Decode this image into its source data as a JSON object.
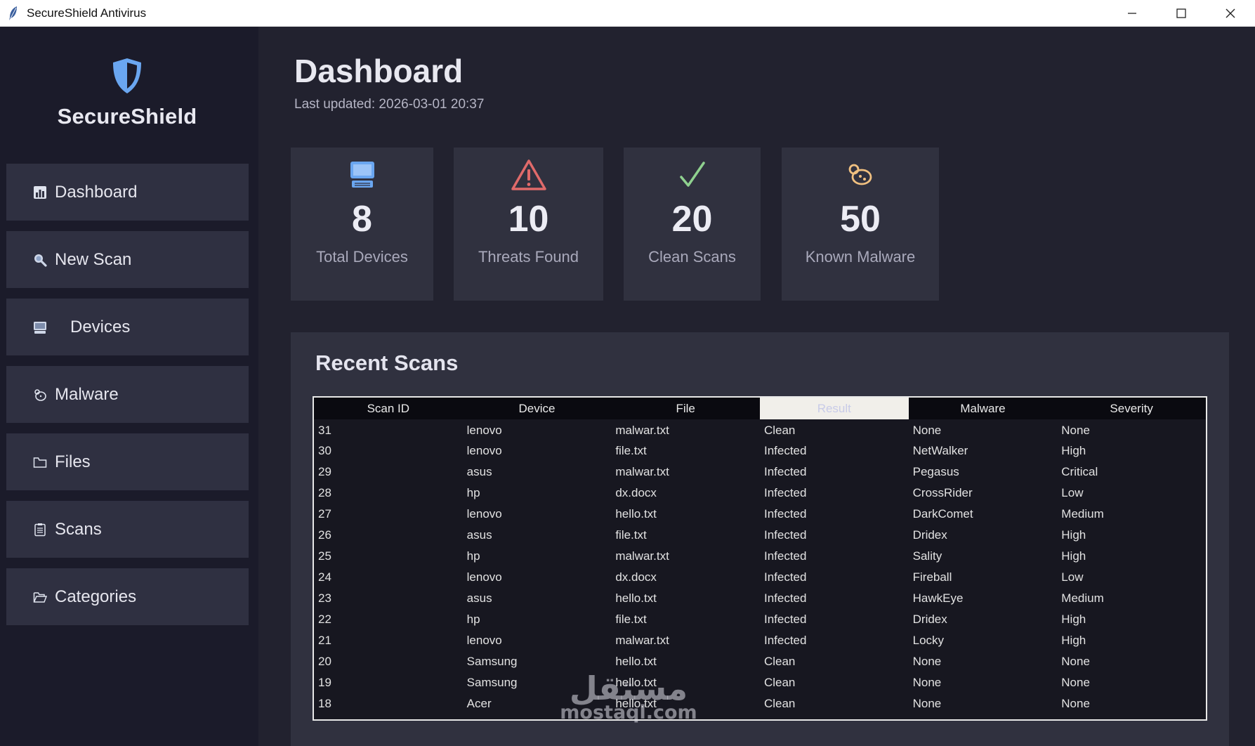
{
  "window": {
    "title": "SecureShield Antivirus"
  },
  "sidebar": {
    "brand": "SecureShield",
    "items": [
      {
        "label": "Dashboard",
        "icon": "bar-chart-icon"
      },
      {
        "label": "New Scan",
        "icon": "magnifier-icon"
      },
      {
        "label": "Devices",
        "icon": "computer-icon"
      },
      {
        "label": "Malware",
        "icon": "bug-icon"
      },
      {
        "label": "Files",
        "icon": "folder-icon"
      },
      {
        "label": "Scans",
        "icon": "clipboard-icon"
      },
      {
        "label": "Categories",
        "icon": "open-folder-icon"
      }
    ]
  },
  "main": {
    "title": "Dashboard",
    "last_updated": "Last updated: 2026-03-01 20:37",
    "stats": [
      {
        "value": "8",
        "label": "Total Devices",
        "icon": "computer-icon"
      },
      {
        "value": "10",
        "label": "Threats Found",
        "icon": "warning-icon"
      },
      {
        "value": "20",
        "label": "Clean Scans",
        "icon": "checkmark-icon"
      },
      {
        "value": "50",
        "label": "Known Malware",
        "icon": "bug-icon"
      }
    ],
    "recent_scans": {
      "title": "Recent Scans",
      "columns": [
        "Scan ID",
        "Device",
        "File",
        "Result",
        "Malware",
        "Severity"
      ],
      "rows": [
        [
          "31",
          "lenovo",
          "malwar.txt",
          "Clean",
          "None",
          "None"
        ],
        [
          "30",
          "lenovo",
          "file.txt",
          "Infected",
          "NetWalker",
          "High"
        ],
        [
          "29",
          "asus",
          "malwar.txt",
          "Infected",
          "Pegasus",
          "Critical"
        ],
        [
          "28",
          "hp",
          "dx.docx",
          "Infected",
          "CrossRider",
          "Low"
        ],
        [
          "27",
          "lenovo",
          "hello.txt",
          "Infected",
          "DarkComet",
          "Medium"
        ],
        [
          "26",
          "asus",
          "file.txt",
          "Infected",
          "Dridex",
          "High"
        ],
        [
          "25",
          "hp",
          "malwar.txt",
          "Infected",
          "Sality",
          "High"
        ],
        [
          "24",
          "lenovo",
          "dx.docx",
          "Infected",
          "Fireball",
          "Low"
        ],
        [
          "23",
          "asus",
          "hello.txt",
          "Infected",
          "HawkEye",
          "Medium"
        ],
        [
          "22",
          "hp",
          "file.txt",
          "Infected",
          "Dridex",
          "High"
        ],
        [
          "21",
          "lenovo",
          "malwar.txt",
          "Infected",
          "Locky",
          "High"
        ],
        [
          "20",
          "Samsung",
          "hello.txt",
          "Clean",
          "None",
          "None"
        ],
        [
          "19",
          "Samsung",
          "hello.txt",
          "Clean",
          "None",
          "None"
        ],
        [
          "18",
          "Acer",
          "hello.txt",
          "Clean",
          "None",
          "None"
        ]
      ]
    }
  },
  "watermark": {
    "arabic": "مستقل",
    "latin": "mostaql.com"
  },
  "colors": {
    "background": "#22222f",
    "sidebar": "#1b1b2a",
    "card": "#30313f",
    "accent": "#6aa6f0",
    "warning": "#e06a6a",
    "success": "#8fd18f",
    "bug": "#f0c080"
  }
}
